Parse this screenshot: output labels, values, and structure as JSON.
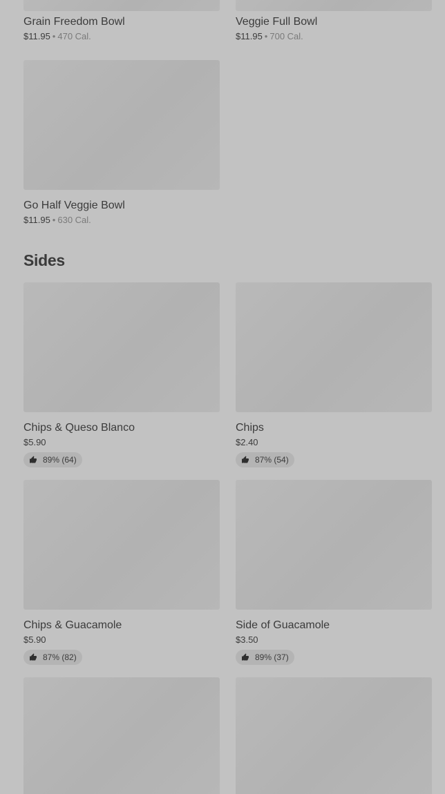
{
  "bowls": [
    {
      "name": "Grain Freedom Bowl",
      "price": "$11.95",
      "separator": "•",
      "calories": "470 Cal."
    },
    {
      "name": "Veggie Full Bowl",
      "price": "$11.95",
      "separator": "•",
      "calories": "700 Cal."
    },
    {
      "name": "Go Half Veggie Bowl",
      "price": "$11.95",
      "separator": "•",
      "calories": "630 Cal."
    }
  ],
  "sides_section": {
    "title": "Sides",
    "items": [
      {
        "name": "Chips & Queso Blanco",
        "price": "$5.90",
        "rating": "89% (64)"
      },
      {
        "name": "Chips",
        "price": "$2.40",
        "rating": "87% (54)"
      },
      {
        "name": "Chips & Guacamole",
        "price": "$5.90",
        "rating": "87% (82)"
      },
      {
        "name": "Side of Guacamole",
        "price": "$3.50",
        "rating": "89% (37)"
      }
    ]
  },
  "icons": {
    "rating": "thumbs-up-icon"
  },
  "colors": {
    "overlay_background": "#c2c2c2",
    "text": "#3b3b3b",
    "muted_text": "#7a7a7a",
    "placeholder_image": "#b5b5b5"
  }
}
